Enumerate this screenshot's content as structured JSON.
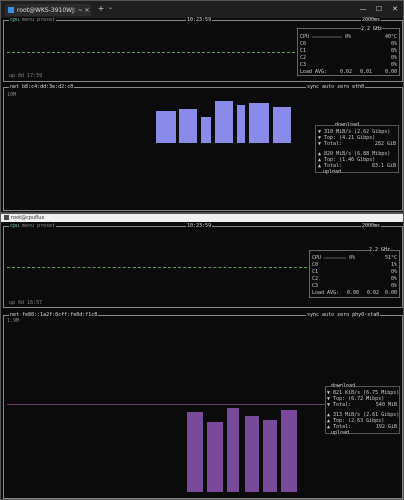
{
  "window1": {
    "tab_title": "root@WKS-3910WJ: ~",
    "time": "10:23:59",
    "refresh": "2000ms",
    "cpu_label": "cpu",
    "menu_modes": "menu preset",
    "cpu_freq": "2.2 GHz",
    "cpu": {
      "label": "CPU",
      "percent": "0%",
      "temp": "40°C"
    },
    "cores": [
      {
        "label": "C0",
        "percent": "0%"
      },
      {
        "label": "C1",
        "percent": "0%"
      },
      {
        "label": "C2",
        "percent": "0%"
      },
      {
        "label": "C3",
        "percent": "0%"
      }
    ],
    "load_avg": {
      "label": "Load AVG:",
      "v1": "0.02",
      "v2": "0.01",
      "v3": "0.00"
    },
    "uptime": "up 0d 17:59",
    "net_header": "net   b8:c4:dd:3e:d2:c0",
    "net_right": "sync auto zero  eth0",
    "net_scale": "10M",
    "download": {
      "label": "download",
      "rate": "310 MiB/s (2.62 Gibps)",
      "top": "(4.21 Gibps)",
      "total": "282 GiB"
    },
    "upload": {
      "label": "upload",
      "rate": "820 MiB/s (6.88 Mibps)",
      "top": "(1.46 Gibps)",
      "total": "83.1 GiB"
    }
  },
  "window2": {
    "title": "root@cpuflux",
    "time": "10:23:59",
    "refresh": "2000ms",
    "cpu_freq": "2.2 GHz",
    "cpu": {
      "label": "CPU",
      "percent": "0%",
      "temp": "51°C"
    },
    "cores": [
      {
        "label": "C0",
        "percent": "1%"
      },
      {
        "label": "C1",
        "percent": "0%"
      },
      {
        "label": "C2",
        "percent": "0%"
      },
      {
        "label": "C3",
        "percent": "0%"
      }
    ],
    "load_avg": {
      "label": "Load AVG:",
      "v1": "0.00",
      "v2": "0.02",
      "v3": "0.00"
    },
    "uptime": "up 0d 16:57",
    "net_header": "net   fe80::1a2f:8cff:fe0d:f1c8",
    "net_right": "sync auto zero  phy0-sta0",
    "net_scale": "1.9M",
    "download": {
      "label": "download",
      "rate": "821 KiB/s (6.75 Mibps)",
      "top": "(6.72 Mibps)",
      "total": "540 MiB"
    },
    "upload": {
      "label": "upload",
      "rate": "313 MiB/s (2.61 Gibps)",
      "top": "(2.63 Gibps)",
      "total": "192 GiB"
    }
  },
  "labels": {
    "total": "Total:",
    "top": "Top:"
  },
  "colors": {
    "graph_green": "#4fa84f",
    "graph_purple": "#7a4a9a",
    "graph_blue": "#8a8ae8"
  }
}
